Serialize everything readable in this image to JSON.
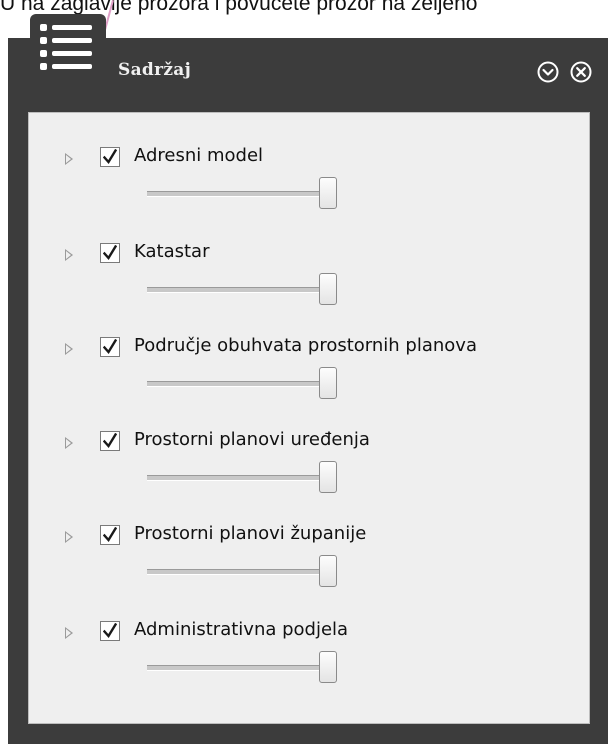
{
  "caption": "U na zaglavlje prozora i povučete prozor na željeno",
  "panel": {
    "title": "Sadržaj",
    "menu_icon": "list-icon",
    "collapse_icon": "chevron-down-circle-icon",
    "close_icon": "close-circle-icon"
  },
  "layers": [
    {
      "label": "Adresni model",
      "checked": true,
      "opacity": 1.0
    },
    {
      "label": "Katastar",
      "checked": true,
      "opacity": 1.0
    },
    {
      "label": "Područje obuhvata prostornih planova",
      "checked": true,
      "opacity": 1.0
    },
    {
      "label": "Prostorni planovi uređenja",
      "checked": true,
      "opacity": 1.0
    },
    {
      "label": "Prostorni planovi županije",
      "checked": true,
      "opacity": 1.0
    },
    {
      "label": "Administrativna podjela",
      "checked": true,
      "opacity": 1.0
    }
  ],
  "colors": {
    "panel_bg": "#3c3c3c",
    "content_bg": "#efefef",
    "title_text": "#f0f0f0"
  }
}
